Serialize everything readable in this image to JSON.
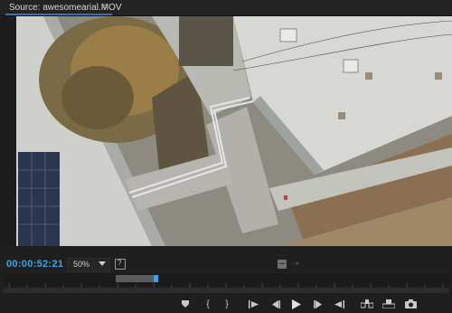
{
  "panel": {
    "tab_title": "Source: awesomearial.MOV",
    "menu_icon": "hamburger-menu-icon"
  },
  "monitor": {
    "timecode": "00:00:52:21",
    "zoom": "50%",
    "zoom_options_visible": [
      "50%"
    ],
    "settings_label": "?"
  },
  "colors": {
    "timecode": "#3ea3e6",
    "playhead": "#3ea3e6",
    "tab_underline": "#3d6fb5",
    "panel_bg": "#1d1d1d"
  },
  "transport": {
    "buttons": [
      {
        "name": "add-marker-icon",
        "glyph": "▼"
      },
      {
        "name": "mark-in-icon",
        "glyph": "{"
      },
      {
        "name": "mark-out-icon",
        "glyph": "}"
      },
      {
        "name": "go-to-in-icon",
        "glyph": "{←"
      },
      {
        "name": "step-back-icon",
        "glyph": "◀|"
      },
      {
        "name": "play-icon",
        "glyph": "▶"
      },
      {
        "name": "step-forward-icon",
        "glyph": "|▶"
      },
      {
        "name": "go-to-out-icon",
        "glyph": "→}"
      },
      {
        "name": "insert-icon",
        "glyph": ""
      },
      {
        "name": "overwrite-icon",
        "glyph": ""
      },
      {
        "name": "export-frame-icon",
        "glyph": ""
      }
    ]
  }
}
